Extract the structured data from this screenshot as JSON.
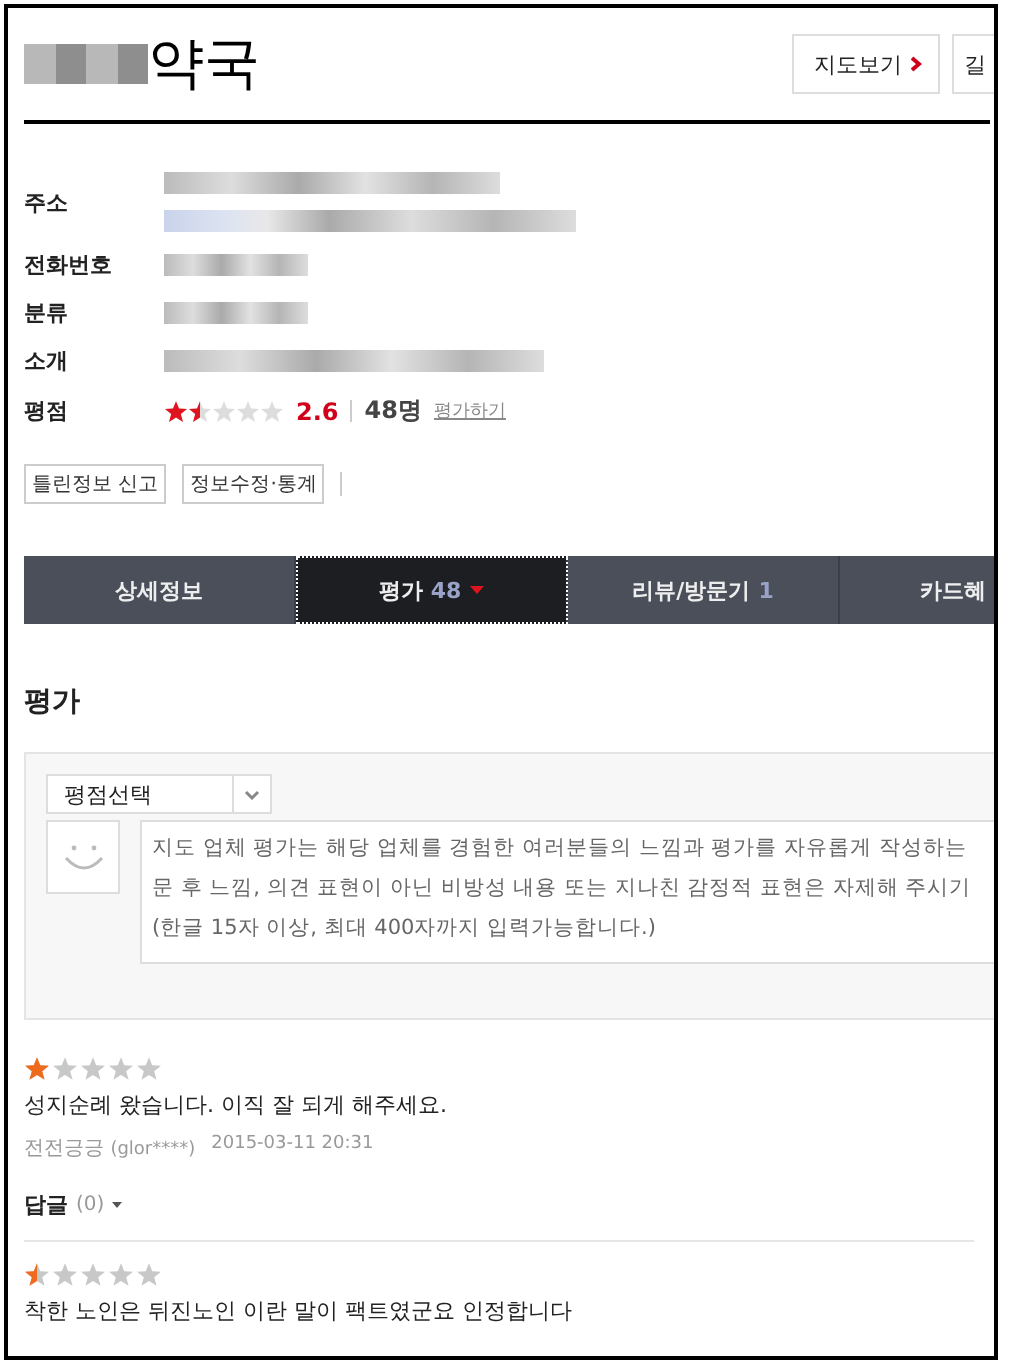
{
  "header": {
    "title": "약국",
    "buttons": [
      {
        "label": "지도보기",
        "kind": "arrow"
      },
      {
        "label": "길",
        "kind": "plain"
      }
    ]
  },
  "info": [
    {
      "label": "주소",
      "kind": "address"
    },
    {
      "label": "전화번호",
      "kind": "short"
    },
    {
      "label": "분류",
      "kind": "short"
    },
    {
      "label": "소개",
      "kind": "long"
    }
  ],
  "rating": {
    "label": "평점",
    "stars": 1.5,
    "score": "2.6",
    "count": "48명",
    "link": "평가하기"
  },
  "actions": [
    "틀린정보 신고",
    "정보수정·통계"
  ],
  "tabs": [
    {
      "label": "상세정보",
      "selected": false
    },
    {
      "label": "평가",
      "count": "48",
      "selected": true
    },
    {
      "label": "리뷰/방문기",
      "count": "1",
      "selected": false
    },
    {
      "label": "카드혜",
      "selected": false
    }
  ],
  "section_title": "평가",
  "form": {
    "select": "평점선택",
    "hint_lines": [
      "지도 업체 평가는 해당 업체를 경험한 여러분들의 느낌과 평가를 자유롭게 작성하는",
      "문 후 느낌, 의견 표현이 아닌 비방성 내용 또는 지나친 감정적 표현은 자제해 주시기",
      "(한글 15자 이상, 최대 400자까지 입력가능합니다.)"
    ]
  },
  "reviews": [
    {
      "stars": 1,
      "text": "성지순례 왔습니다. 이직 잘 되게 해주세요.",
      "author": "전전긍긍",
      "user_id": "(glor****)",
      "date": "2015-03-11 20:31",
      "reply_label": "답글",
      "reply_count": "(0)"
    },
    {
      "stars": 0.5,
      "text": "착한 노인은 뒤진노인 이란 말이 팩트였군요 인정합니다"
    }
  ]
}
